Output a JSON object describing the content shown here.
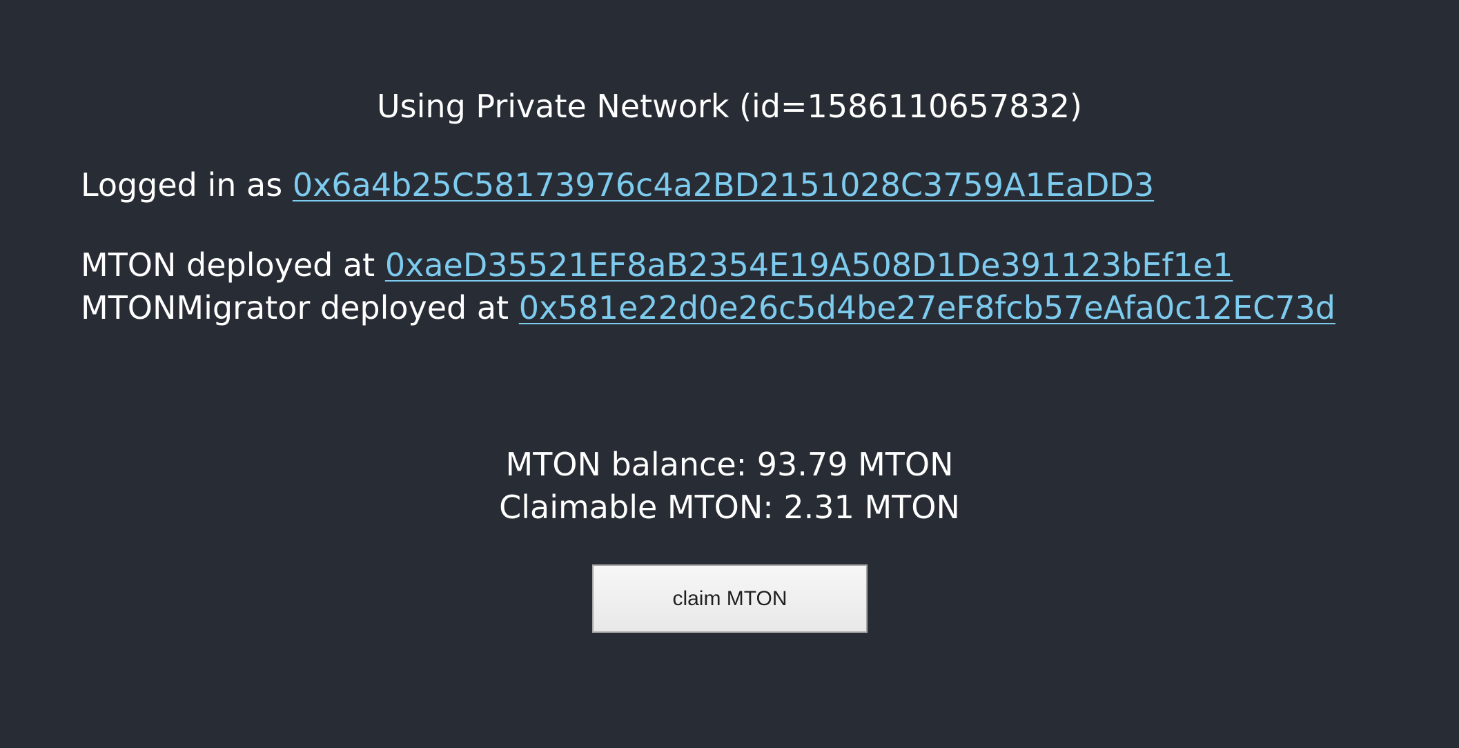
{
  "network": {
    "text": "Using Private Network (id=1586110657832)"
  },
  "login": {
    "prefix": "Logged in as",
    "address": "0x6a4b25C58173976c4a2BD2151028C3759A1EaDD3"
  },
  "contracts": {
    "mton_prefix": "MTON deployed at",
    "mton_address": "0xaeD35521EF8aB2354E19A508D1De391123bEf1e1",
    "migrator_prefix": "MTONMigrator deployed at",
    "migrator_address": "0x581e22d0e26c5d4be27eF8fcb57eAfa0c12EC73d"
  },
  "balances": {
    "balance": "MTON balance: 93.79 MTON",
    "claimable": "Claimable MTON: 2.31 MTON"
  },
  "actions": {
    "claim_label": "claim MTON"
  },
  "colors": {
    "background": "#282c34",
    "text": "#ffffff",
    "link": "#7dcbee"
  }
}
